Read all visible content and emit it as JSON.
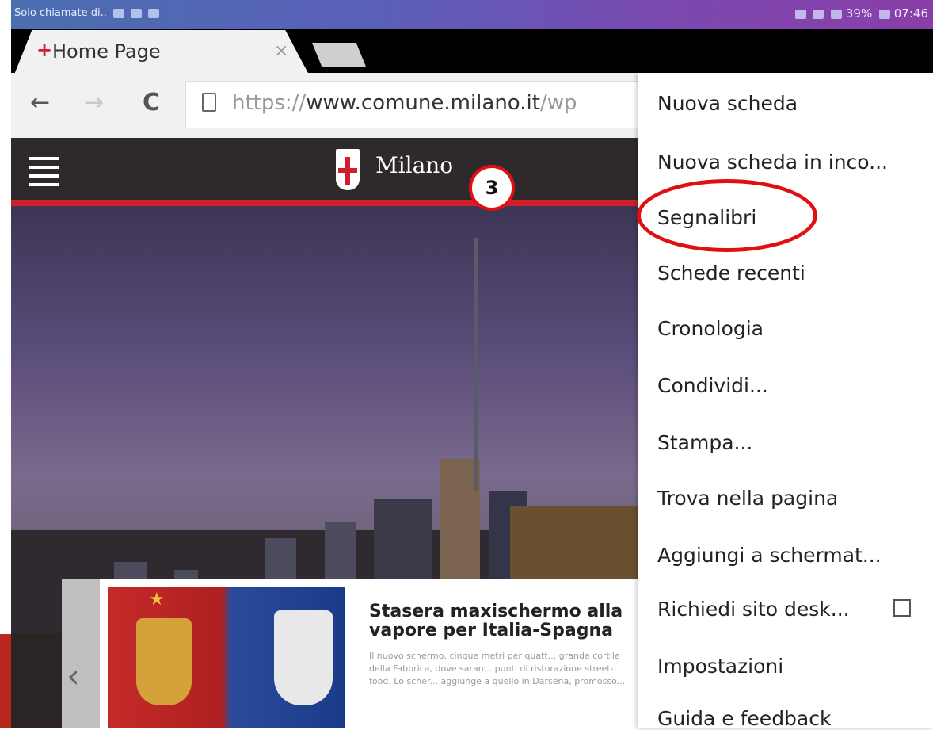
{
  "status_bar": {
    "left_text": "Solo chiamate di..",
    "right_text": "39%",
    "time": "07:46"
  },
  "tab": {
    "title": "Home Page",
    "close_label": "×",
    "favicon": "+"
  },
  "toolbar": {
    "back": "←",
    "forward": "→",
    "reload": "C",
    "url_scheme": "https://",
    "url_host": "www.comune.milano.it",
    "url_path": "/wp"
  },
  "site": {
    "brand": "Milano"
  },
  "card": {
    "title": "Stasera maxischermo alla vapore per Italia-Spagna",
    "text": "Il nuovo schermo, cinque metri per quatt... grande cortile della Fabbrica, dove saran... punti di ristorazione street-food. Lo scher... aggiunge a quello in Darsena, promosso...",
    "prev": "‹"
  },
  "step_badge": "3",
  "menu": {
    "items": [
      "Nuova scheda",
      "Nuova scheda in inco...",
      "Segnalibri",
      "Schede recenti",
      "Cronologia",
      "Condividi...",
      "Stampa...",
      "Trova nella pagina",
      "Aggiungi a schermat...",
      "Richiedi sito desk...",
      "Impostazioni",
      "Guida e feedback"
    ],
    "highlighted": "Segnalibri"
  },
  "colors": {
    "accent_red": "#e01010",
    "milano_red": "#d01e2a",
    "header_dark": "#2e2a2c"
  }
}
